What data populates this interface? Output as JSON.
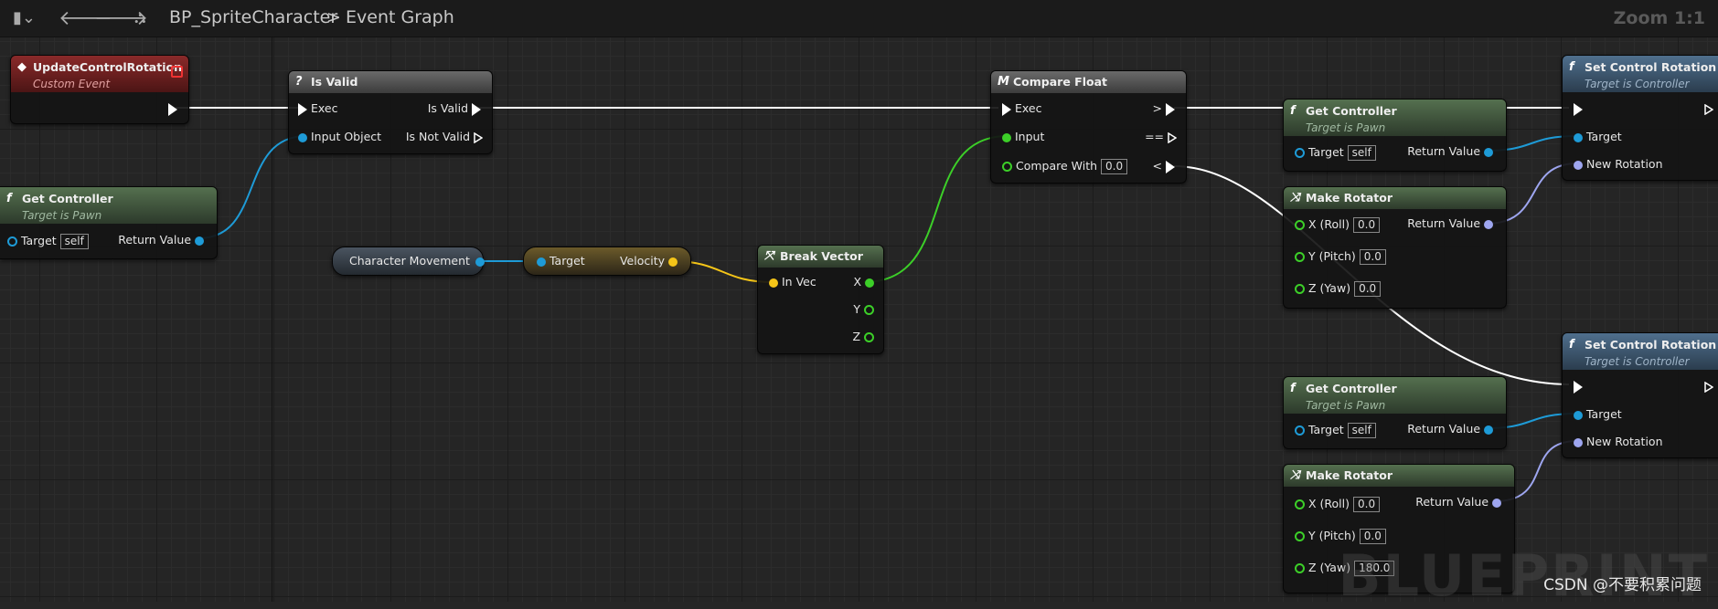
{
  "topbar": {
    "title": "BP_SpriteCharacter",
    "separator": ">",
    "graph": "Event Graph",
    "zoom": "Zoom 1:1"
  },
  "watermark": "BLUEPRINT",
  "credit": "CSDN @不要积累问题",
  "colors": {
    "exec": "#ffffff",
    "object": "#1e9bd7",
    "float": "#3ccf28",
    "vector": "#f5c518",
    "rotator": "#9ea6f0"
  },
  "nodes": {
    "event": {
      "title": "UpdateControlRotation",
      "subtitle": "Custom Event"
    },
    "isvalid": {
      "title": "Is Valid",
      "exec": "Exec",
      "input_object": "Input Object",
      "is_valid": "Is Valid",
      "is_not_valid": "Is Not Valid"
    },
    "getctrl1": {
      "title": "Get Controller",
      "subtitle": "Target is Pawn",
      "target": "Target",
      "self": "self",
      "return": "Return Value"
    },
    "charmove": {
      "label": "Character Movement"
    },
    "velocity": {
      "target": "Target",
      "velocity": "Velocity"
    },
    "breakvec": {
      "title": "Break Vector",
      "in": "In Vec",
      "x": "X",
      "y": "Y",
      "z": "Z"
    },
    "compare": {
      "title": "Compare Float",
      "exec": "Exec",
      "input": "Input",
      "compare_with": "Compare With",
      "compare_val": "0.0",
      "gt": ">",
      "eq": "==",
      "lt": "<"
    },
    "getctrl2": {
      "title": "Get Controller",
      "subtitle": "Target is Pawn",
      "target": "Target",
      "self": "self",
      "return": "Return Value"
    },
    "setrot1": {
      "title": "Set Control Rotation",
      "subtitle": "Target is Controller",
      "target": "Target",
      "new_rot": "New Rotation"
    },
    "makerot1": {
      "title": "Make Rotator",
      "x": "X (Roll)",
      "xv": "0.0",
      "y": "Y (Pitch)",
      "yv": "0.0",
      "z": "Z (Yaw)",
      "zv": "0.0",
      "return": "Return Value"
    },
    "getctrl3": {
      "title": "Get Controller",
      "subtitle": "Target is Pawn",
      "target": "Target",
      "self": "self",
      "return": "Return Value"
    },
    "setrot2": {
      "title": "Set Control Rotation",
      "subtitle": "Target is Controller",
      "target": "Target",
      "new_rot": "New Rotation"
    },
    "makerot2": {
      "title": "Make Rotator",
      "x": "X (Roll)",
      "xv": "0.0",
      "y": "Y (Pitch)",
      "yv": "0.0",
      "z": "Z (Yaw)",
      "zv": "180.0",
      "return": "Return Value"
    }
  }
}
